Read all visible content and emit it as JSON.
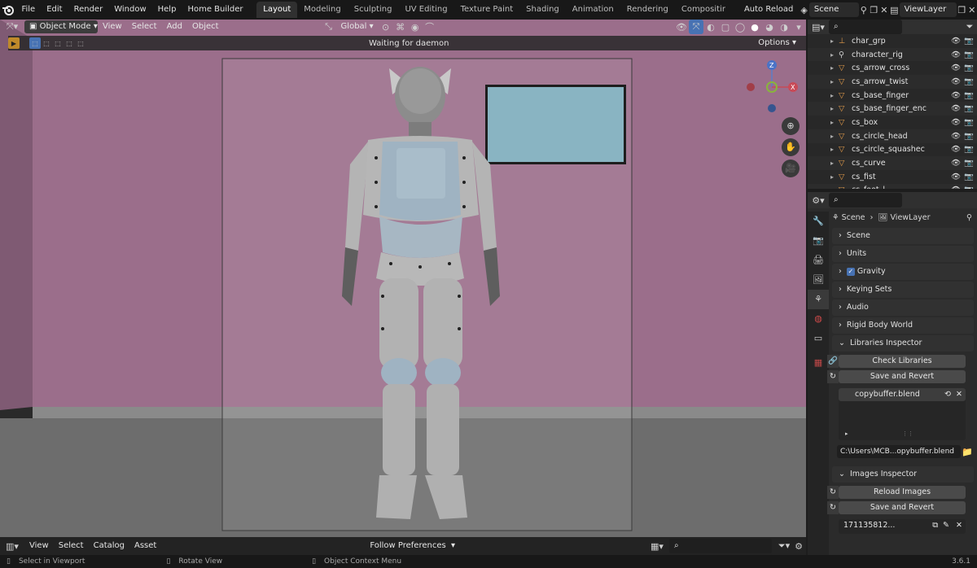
{
  "topbar": {
    "menus": [
      "File",
      "Edit",
      "Render",
      "Window",
      "Help",
      "Home Builder"
    ],
    "workspace_tabs": [
      "Layout",
      "Modeling",
      "Sculpting",
      "UV Editing",
      "Texture Paint",
      "Shading",
      "Animation",
      "Rendering",
      "Compositir"
    ],
    "active_tab": "Layout",
    "auto_reload": "Auto Reload",
    "scene": "Scene",
    "view_layer": "ViewLayer"
  },
  "viewport": {
    "mode": "Object Mode",
    "menus": [
      "View",
      "Select",
      "Add",
      "Object"
    ],
    "orientation": "Global",
    "options": "Options",
    "status": "Waiting for daemon"
  },
  "outliner": {
    "items": [
      {
        "name": "char_grp",
        "type": "bone"
      },
      {
        "name": "character_rig",
        "type": "armature"
      },
      {
        "name": "cs_arrow_cross",
        "type": "mesh"
      },
      {
        "name": "cs_arrow_twist",
        "type": "mesh"
      },
      {
        "name": "cs_base_finger",
        "type": "mesh"
      },
      {
        "name": "cs_base_finger_enc",
        "type": "mesh"
      },
      {
        "name": "cs_box",
        "type": "mesh"
      },
      {
        "name": "cs_circle_head",
        "type": "mesh"
      },
      {
        "name": "cs_circle_squashec",
        "type": "mesh"
      },
      {
        "name": "cs_curve",
        "type": "mesh"
      },
      {
        "name": "cs_fist",
        "type": "mesh"
      },
      {
        "name": "cs_foot_l",
        "type": "mesh"
      }
    ]
  },
  "properties": {
    "breadcrumb_scene": "Scene",
    "breadcrumb_layer": "ViewLayer",
    "panels": [
      "Scene",
      "Units",
      "Gravity",
      "Keying Sets",
      "Audio",
      "Rigid Body World"
    ],
    "gravity_checked": true,
    "libraries_inspector": {
      "title": "Libraries Inspector",
      "check_libraries": "Check Libraries",
      "save_and_revert": "Save and Revert",
      "library_item": "copybuffer.blend",
      "path": "C:\\Users\\MCB...opybuffer.blend"
    },
    "images_inspector": {
      "title": "Images Inspector",
      "reload_images": "Reload Images",
      "save_and_revert": "Save and Revert",
      "image_item": "171135812..."
    }
  },
  "assetbar": {
    "menus": [
      "View",
      "Select",
      "Catalog",
      "Asset"
    ],
    "follow": "Follow Preferences"
  },
  "statusbar": {
    "select": "Select in Viewport",
    "rotate": "Rotate View",
    "context": "Object Context Menu",
    "version": "3.6.1"
  },
  "colors": {
    "wall": "#a77596",
    "floor": "#7a7a7a",
    "robot_body": "#9fb3c2",
    "robot_metal": "#b8b8b8",
    "tv_screen": "#89b4c2"
  }
}
